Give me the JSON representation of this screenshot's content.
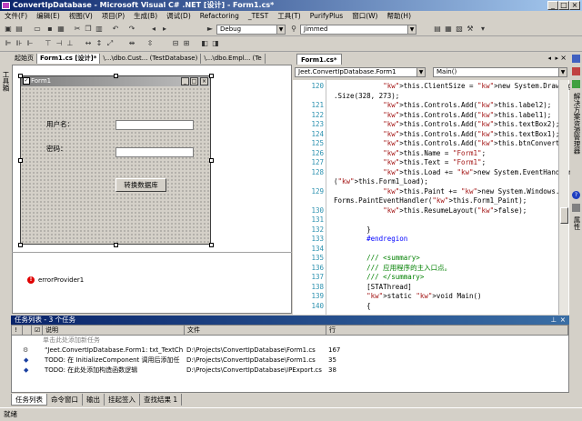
{
  "window": {
    "title": "ConvertIpDatabase - Microsoft Visual C# .NET [设计] - Form1.cs*"
  },
  "menu": [
    "文件(F)",
    "编辑(E)",
    "视图(V)",
    "项目(P)",
    "生成(B)",
    "调试(D)",
    "Refactoring",
    "_TEST",
    "工具(T)",
    "PurifyPlus",
    "窗口(W)",
    "帮助(H)"
  ],
  "toolbar": {
    "config": "Debug",
    "find": "Jimmed"
  },
  "left_sidebar": {
    "label": "工具箱"
  },
  "right_sidebar": {
    "label1": "解决方案资源管理器",
    "label2": "属性"
  },
  "design_tabs": [
    "起始页",
    "Form1.cs [设计]*",
    "\\...\\dbo.Cust... (TestDatabase)",
    "\\...\\dbo.Empl... (Te"
  ],
  "form": {
    "title": "Form1",
    "label_user": "用户名：",
    "label_pass": "密码：",
    "button": "转换数据库"
  },
  "component_tray": {
    "item": "errorProvider1"
  },
  "code_tab": "Form1.cs*",
  "code_combos": {
    "class": "Jeet.ConvertIpDatabase.Form1",
    "member": "Main()"
  },
  "code_lines": [
    {
      "n": "120",
      "t": "            this.ClientSize = new System.Drawing"
    },
    {
      "n": "",
      "t": ".Size(328, 273);"
    },
    {
      "n": "121",
      "t": "            this.Controls.Add(this.label2);"
    },
    {
      "n": "122",
      "t": "            this.Controls.Add(this.label1);"
    },
    {
      "n": "123",
      "t": "            this.Controls.Add(this.textBox2);"
    },
    {
      "n": "124",
      "t": "            this.Controls.Add(this.textBox1);"
    },
    {
      "n": "125",
      "t": "            this.Controls.Add(this.btnConvert);"
    },
    {
      "n": "126",
      "t": "            this.Name = \"Form1\";"
    },
    {
      "n": "127",
      "t": "            this.Text = \"Form1\";"
    },
    {
      "n": "128",
      "t": "            this.Load += new System.EventHandler"
    },
    {
      "n": "",
      "t": "(this.Form1_Load);"
    },
    {
      "n": "129",
      "t": "            this.Paint += new System.Windows."
    },
    {
      "n": "",
      "t": "Forms.PaintEventHandler(this.Form1_Paint);"
    },
    {
      "n": "130",
      "t": "            this.ResumeLayout(false);"
    },
    {
      "n": "131",
      "t": ""
    },
    {
      "n": "132",
      "t": "        }"
    },
    {
      "n": "133",
      "t": "        #endregion"
    },
    {
      "n": "134",
      "t": ""
    },
    {
      "n": "135",
      "t": "        /// <summary>"
    },
    {
      "n": "136",
      "t": "        /// 应用程序的主入口点。"
    },
    {
      "n": "137",
      "t": "        /// </summary>"
    },
    {
      "n": "138",
      "t": "        [STAThread]"
    },
    {
      "n": "139",
      "t": "        static void Main()"
    },
    {
      "n": "140",
      "t": "        {"
    }
  ],
  "task_list": {
    "title": "任务列表 - 3 个任务",
    "headers": {
      "desc": "说明",
      "file": "文件",
      "line": "行"
    },
    "add_placeholder": "单击此处添加新任务",
    "rows": [
      {
        "desc": "“Jeet.ConvertIpDatabase.Form1: txt_TextCh",
        "file": "D:\\Projects\\ConvertIpDatabase\\Form1.cs",
        "line": "167"
      },
      {
        "desc": "TODO: 在 InitializeComponent 调用后添加任",
        "file": "D:\\Projects\\ConvertIpDatabase\\Form1.cs",
        "line": "35"
      },
      {
        "desc": "TODO: 在此处添加构造函数逻辑",
        "file": "D:\\Projects\\ConvertIpDatabase\\IPExport.cs",
        "line": "38"
      }
    ]
  },
  "bottom_tabs": [
    "任务列表",
    "命令窗口",
    "输出",
    "挂起签入",
    "查找结果 1"
  ],
  "status": {
    "text": "就绪"
  }
}
